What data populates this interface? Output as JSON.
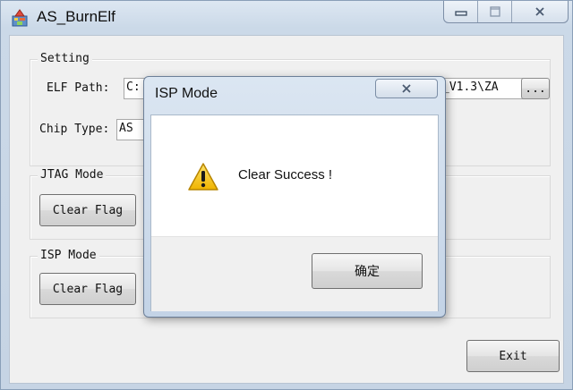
{
  "window": {
    "title": "AS_BurnElf",
    "icon": "app-icon",
    "minimize_icon": "minimize-icon",
    "maximize_icon": "maximize-icon",
    "close_icon": "close-icon"
  },
  "setting": {
    "legend": "Setting",
    "elf_path_label": "ELF Path:",
    "elf_path_value_left": "C:",
    "elf_path_value_right": "_V1.3\\ZA",
    "browse_label": "...",
    "chip_type_label": "Chip Type:",
    "chip_type_value": "AS"
  },
  "jtag": {
    "legend": "JTAG Mode",
    "clear_flag_label": "Clear Flag"
  },
  "isp": {
    "legend": "ISP Mode",
    "clear_flag_label": "Clear Flag"
  },
  "exit_label": "Exit",
  "dialog": {
    "title": "ISP Mode",
    "message": "Clear Success !",
    "ok_label": "确定",
    "icon": "warning-icon",
    "close_icon": "close-icon"
  },
  "colors": {
    "title_gradient_top": "#dde7f2",
    "client_bg": "#f0f0f0",
    "warning_yellow": "#f5c21b"
  }
}
